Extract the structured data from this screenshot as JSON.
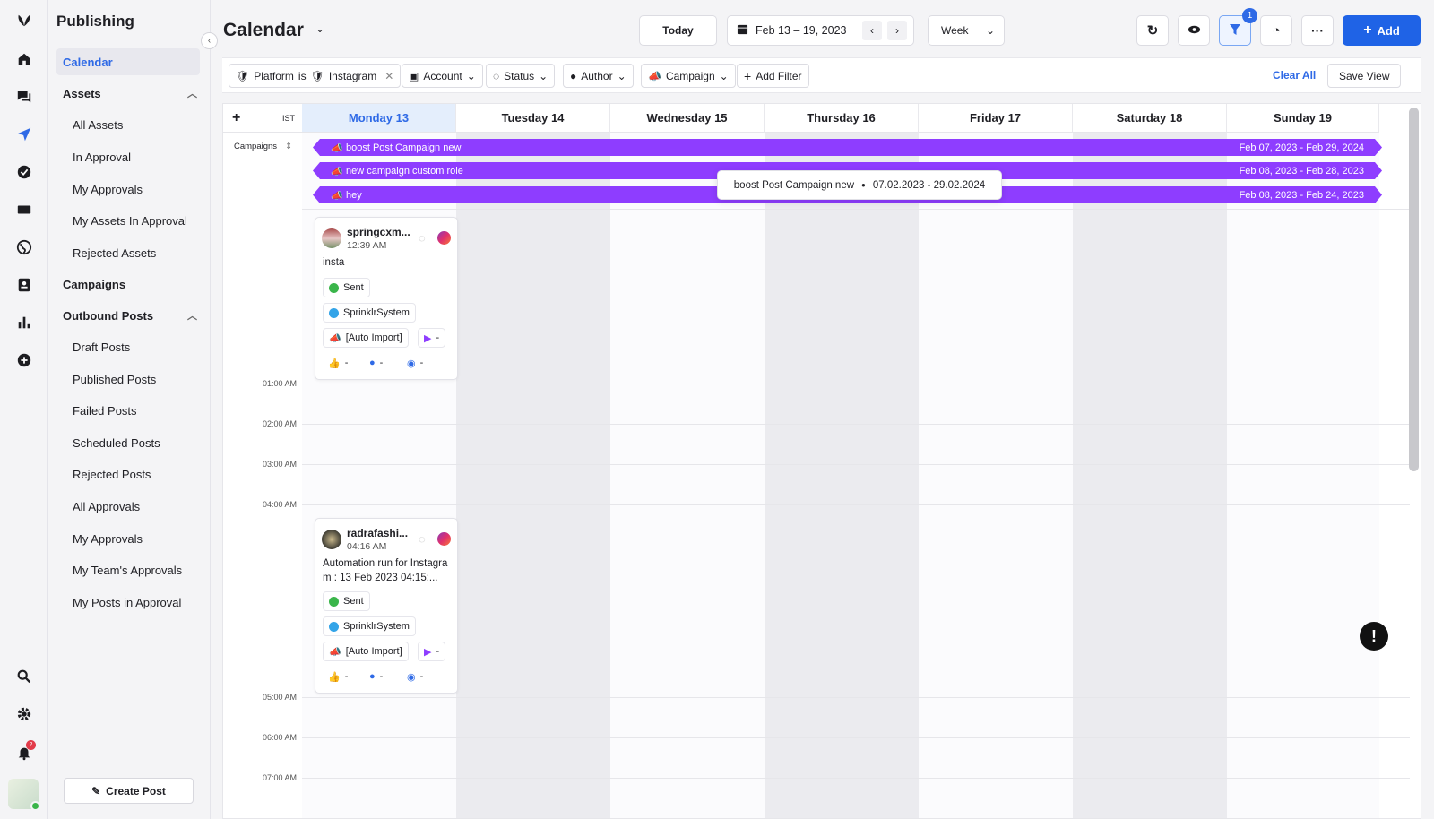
{
  "app": {
    "section_title": "Publishing"
  },
  "sidebar": {
    "calendar": "Calendar",
    "assets_header": "Assets",
    "assets": [
      "All Assets",
      "In Approval",
      "My Approvals",
      "My Assets In Approval",
      "Rejected Assets"
    ],
    "campaigns": "Campaigns",
    "outbound_header": "Outbound Posts",
    "outbound": [
      "Draft Posts",
      "Published Posts",
      "Failed Posts",
      "Scheduled Posts",
      "Rejected Posts",
      "All Approvals",
      "My Approvals",
      "My Team's Approvals",
      "My Posts in Approval"
    ],
    "create_post": "Create Post",
    "notification_count": "2"
  },
  "header": {
    "title": "Calendar",
    "today": "Today",
    "date_range": "Feb 13 – 19, 2023",
    "view": "Week",
    "filter_badge": "1",
    "add": "Add"
  },
  "filters": {
    "platform_label": "Platform",
    "platform_op": "is",
    "platform_value": "Instagram",
    "account": "Account",
    "status": "Status",
    "author": "Author",
    "campaign": "Campaign",
    "add_filter": "Add Filter",
    "clear_all": "Clear All",
    "save_view": "Save View"
  },
  "calendar": {
    "timezone": "IST",
    "campaigns_label": "Campaigns",
    "days": [
      "Monday 13",
      "Tuesday 14",
      "Wednesday 15",
      "Thursday 16",
      "Friday 17",
      "Saturday 18",
      "Sunday 19"
    ],
    "times": [
      "01:00 AM",
      "02:00 AM",
      "03:00 AM",
      "04:00 AM",
      "05:00 AM",
      "06:00 AM",
      "07:00 AM"
    ],
    "campaigns": [
      {
        "name": "boost Post Campaign new",
        "dates": "Feb 07, 2023 - Feb 29, 2024"
      },
      {
        "name": "new campaign custom role",
        "dates": "Feb 08, 2023 - Feb 28, 2023"
      },
      {
        "name": "hey",
        "dates": "Feb 08, 2023 - Feb 24, 2023"
      }
    ],
    "tooltip": {
      "name": "boost Post Campaign new",
      "dates": "07.02.2023 - 29.02.2024"
    },
    "posts": [
      {
        "user": "springcxm...",
        "time": "12:39 AM",
        "text": "insta",
        "status": "Sent",
        "system": "SprinklrSystem",
        "campaign": "[Auto Import]",
        "tag": "-",
        "likes": "-",
        "comments": "-",
        "views": "-"
      },
      {
        "user": "radrafashi...",
        "time": "04:16 AM",
        "text": "Automation run for Instagram : 13 Feb 2023 04:15:...",
        "status": "Sent",
        "system": "SprinklrSystem",
        "campaign": "[Auto Import]",
        "tag": "-",
        "likes": "-",
        "comments": "-",
        "views": "-"
      }
    ]
  },
  "colors": {
    "accent": "#2f6ae6",
    "campaign": "#8e3dff",
    "sent": "#3ab54a"
  }
}
